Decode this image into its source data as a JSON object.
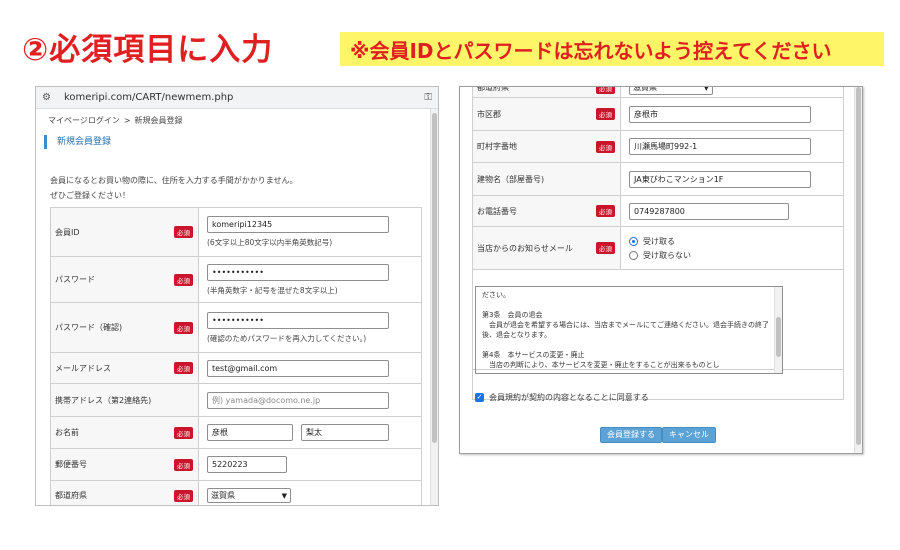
{
  "header": {
    "step_title": "②必須項目に入力",
    "note": "※会員IDとパスワードは忘れないよう控えてください"
  },
  "browser": {
    "url": "komeripi.com/CART/newmem.php",
    "tune_icon": "tune-icon",
    "key_icon": "key-icon"
  },
  "breadcrumb": {
    "login": "マイページログイン",
    "sep": ">",
    "current": "新規会員登録"
  },
  "page_heading": "新規会員登録",
  "intro": {
    "line1": "会員になるとお買い物の際に、住所を入力する手間がかかりません。",
    "line2": "ぜひご登録ください！"
  },
  "required_label": "必須",
  "form": {
    "member_id": {
      "label": "会員ID",
      "value": "komeripi12345",
      "hint": "(6文字以上80文字以内半角英数記号)"
    },
    "password": {
      "label": "パスワード",
      "value": "•••••••••••",
      "hint": "(半角英数字・記号を混ぜた8文字以上)"
    },
    "password_confirm": {
      "label": "パスワード（確認)",
      "value": "•••••••••••",
      "hint": "(確認のためパスワードを再入力してください。)"
    },
    "email": {
      "label": "メールアドレス",
      "value": "test@gmail.com"
    },
    "mobile_email": {
      "label": "携帯アドレス（第2連絡先)",
      "placeholder": "例) yamada@docomo.ne.jp"
    },
    "name": {
      "label": "お名前",
      "last": "彦根",
      "first": "梨太"
    },
    "postal": {
      "label": "郵便番号",
      "value": "5220223"
    },
    "prefecture": {
      "label": "都道府県",
      "value": "滋賀県"
    },
    "city": {
      "label": "市区郡",
      "value": "彦根市"
    },
    "town": {
      "label": "町村字番地",
      "value": "川瀬馬場町992-1"
    },
    "building": {
      "label": "建物名（部屋番号)",
      "value": "JA東びわこマンション1F"
    },
    "phone": {
      "label": "お電話番号",
      "value": "0749287800"
    },
    "newsletter": {
      "label": "当店からのお知らせメール",
      "opt_yes": "受け取る",
      "opt_no": "受け取らない"
    }
  },
  "terms": {
    "text": "ださい。\n\n第3条　会員の退会\n　会員が退会を希望する場合には、当店までメールにてご連絡ください。退会手続きの終了後、退会となります。\n\n第4条　本サービスの変更・廃止\n　当店の判断により、本サービスを変更・廃止をすることが出来るものとし"
  },
  "agree_label": "会員規約が契約の内容となることに同意する",
  "buttons": {
    "submit": "会員登録する",
    "cancel": "キャンセル"
  },
  "colors": {
    "accent_red": "#e02020",
    "note_bg": "#fff568",
    "required_bg": "#c9162b",
    "button_blue": "#5ba3d6",
    "heading_blue": "#3d8bc9"
  }
}
